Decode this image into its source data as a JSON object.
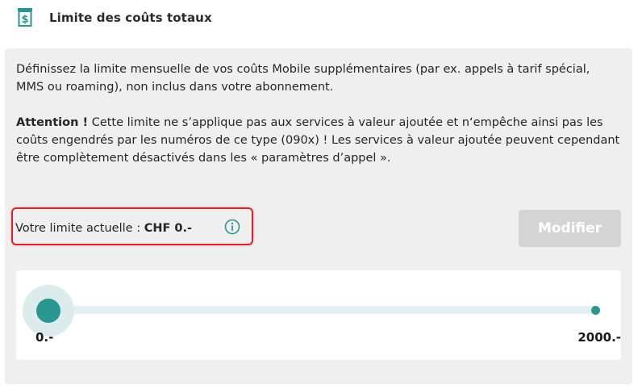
{
  "header": {
    "title": "Limite des coûts totaux",
    "icon": "bill-dollar-icon"
  },
  "description": {
    "text": "Définissez la limite mensuelle de vos coûts Mobile supplémentaires (par ex. appels à tarif spécial, MMS ou roaming), non inclus dans votre abonnement.",
    "warning_label": "Attention !",
    "warning_text": " Cette limite ne s’applique pas aux services à valeur ajoutée et n‘empêche ainsi pas les coûts engendrés par les numéros de ce type (090x) ! Les services à valeur ajoutée peuvent cependant être complètement désactivés dans les « paramètres d’appel »."
  },
  "limit": {
    "label": "Votre limite actuelle : ",
    "value": "CHF 0.-",
    "info_icon": "info-circle-icon"
  },
  "modify_button": {
    "label": "Modifier",
    "enabled": false
  },
  "slider": {
    "min_label": "0.-",
    "max_label": "2000.-",
    "min": 0,
    "max": 2000,
    "value": 0
  },
  "colors": {
    "accent": "#2a9690",
    "panel": "#efefef",
    "highlight_border": "#e0202a",
    "button_disabled": "#d4d4d4"
  }
}
